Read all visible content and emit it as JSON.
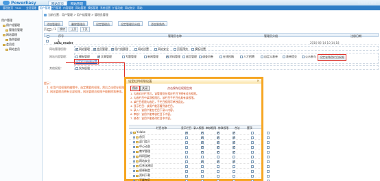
{
  "app": {
    "logo_text": "PowerEasy",
    "top_tabs": [
      "网站首页",
      "网站管理"
    ],
    "nav_items": [
      "管理首页",
      "Y6.6",
      "会员管理",
      "用户管理",
      "栏目管理",
      "内容管理",
      "网站管理",
      "模板管理",
      "系统设置",
      "扩展功能",
      "网站统计",
      "帮助"
    ],
    "nav_active_index": 3,
    "nav_right": "在线帮助 | 退出"
  },
  "sidebar": {
    "items": [
      "用户管理",
      "用户组管理",
      "管理员管理",
      "网站管理",
      "角色管理",
      "会员组",
      "网站会员"
    ]
  },
  "breadcrumb": "当前位置：用户管理 > 用户组管理 > 管理员管理",
  "toolbar": {
    "buttons": [
      "添加管理员",
      "删除管理员",
      "设定管理员",
      "设定管理员分组",
      "添加到角色"
    ]
  },
  "pager": {
    "page_label": "页",
    "input_value": "1",
    "total": "/ 1",
    "btn_go": "跳转",
    "btn_prev": "上页",
    "btn_next": "下页"
  },
  "grid": {
    "headers": [
      "",
      "序号",
      "管理员名称",
      "管理员分组",
      "注册日期"
    ],
    "row": {
      "index": "1",
      "name": "cailu_reader",
      "role": "admin",
      "date": "2016-06-14 10:14:18"
    }
  },
  "permissions": {
    "label_1": "网站管理权限：",
    "items_1": [
      {
        "label": "网站管理",
        "checked": true
      },
      {
        "label": "会员管理",
        "checked": true
      },
      {
        "label": "用户组管理",
        "checked": true
      },
      {
        "label": "网站设置",
        "checked": false
      },
      {
        "label": "网站安全",
        "checked": false
      },
      {
        "label": "页面预览",
        "checked": false
      },
      {
        "label": "模板设置",
        "checked": false
      }
    ],
    "label_2": "网站内容管理：",
    "items_2": [
      {
        "label": "模板管理",
        "checked": false
      },
      {
        "label": "文章管理",
        "checked": true
      },
      {
        "label": "专题管理",
        "checked": false
      },
      {
        "label": "新闻管理",
        "checked": false
      },
      {
        "label": "资料管理",
        "checked": true
      },
      {
        "label": "留言管理",
        "checked": false
      },
      {
        "label": "调查问卷",
        "checked": false
      },
      {
        "label": "在线投稿",
        "checked": false
      },
      {
        "label": "人才招聘",
        "checked": false
      },
      {
        "label": "自定义表单",
        "checked": false
      },
      {
        "label": "表单提交",
        "checked": false
      },
      {
        "label": "公示参与",
        "checked": false
      }
    ],
    "label_3": "其他权限：",
    "items_3": [
      {
        "label": "发布权限",
        "checked": false
      }
    ],
    "edit_link": "设定栏目权限设置",
    "set_button": "设定该角色栏目权限"
  },
  "tips": {
    "title": "提示：",
    "lines": [
      "1. 在用户组权限的编辑中，选定需要的权限，然后点击保存权限完成权限的设定。",
      "2. 网站管理员拥有全部权限，网站管理员权限不能删除和更改。"
    ]
  },
  "dialog": {
    "title": "设定栏目权限设置",
    "close": "×",
    "btn_save": "保存",
    "btn_close": "关闭",
    "hint": "点击保存后权限生效",
    "notes": [
      "1. 勾选对应栏目后，该管理员在相应栏目下拥有对应权限。",
      "2. 勾选栏目中某项权限后，该栏目子栏目也具有该权限。",
      "3. 某栏目权限勾选后，子栏目权限可单独设定。",
      "4. 显示栏目：该用户能否看到该栏目。",
      "5. 录入：该用户能在栏目下录入内容。",
      "6. 审核：该用户能审核栏目下内容。",
      "7. 修改：该用户能修改栏目中内容。"
    ],
    "columns": [
      "栏目名称",
      "显示栏目",
      "录入权限",
      "审核权限",
      "修改权限",
      "合法",
      "置顶"
    ],
    "rows": [
      {
        "name": "Yxlake",
        "cells": [
          true,
          true,
          true,
          true,
          false,
          false
        ]
      },
      {
        "name": "首页",
        "cells": [
          false,
          true,
          true,
          true,
          false,
          false
        ]
      },
      {
        "name": "部门简介",
        "cells": [
          false,
          true,
          true,
          true,
          false,
          false
        ]
      },
      {
        "name": "中心动态",
        "cells": [
          false,
          true,
          true,
          true,
          false,
          false
        ]
      },
      {
        "name": "教学管理",
        "cells": [
          false,
          true,
          true,
          true,
          false,
          false
        ]
      },
      {
        "name": "科研园地",
        "cells": [
          false,
          false,
          false,
          false,
          false,
          false
        ]
      },
      {
        "name": "网站安全",
        "cells": [
          false,
          true,
          true,
          true,
          false,
          false
        ]
      },
      {
        "name": "信息化建设",
        "cells": [
          false,
          false,
          false,
          false,
          false,
          false
        ]
      },
      {
        "name": "规章制度",
        "cells": [
          false,
          false,
          false,
          false,
          false,
          false
        ]
      },
      {
        "name": "资料下载",
        "cells": [
          false,
          false,
          false,
          false,
          false,
          false
        ]
      },
      {
        "name": "下载专区",
        "cells": [
          false,
          false,
          false,
          false,
          false,
          false
        ]
      }
    ]
  },
  "colors": {
    "brand": "#2f7ec6",
    "dialog_border": "#f6a623",
    "tip": "#e05a1c",
    "highlight": "#e0332b"
  }
}
